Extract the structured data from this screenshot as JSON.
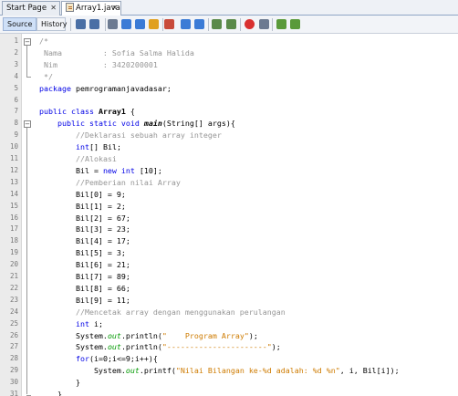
{
  "tabs": [
    {
      "label": "Start Page",
      "close": "✕"
    },
    {
      "label": "Array1.java",
      "close": "✕"
    }
  ],
  "toolbar": {
    "source_label": "Source",
    "history_label": "History"
  },
  "lines": [
    {
      "n": "1",
      "segs": [
        [
          "c",
          "/*"
        ]
      ]
    },
    {
      "n": "2",
      "segs": [
        [
          "c",
          " Nama         : Sofia Salma Halida"
        ]
      ]
    },
    {
      "n": "3",
      "segs": [
        [
          "c",
          " Nim          : 3420200001"
        ]
      ]
    },
    {
      "n": "4",
      "segs": [
        [
          "c",
          " */"
        ]
      ]
    },
    {
      "n": "5",
      "segs": [
        [
          "k",
          "package"
        ],
        [
          "n",
          " pemrogramanjavadasar;"
        ]
      ]
    },
    {
      "n": "6",
      "segs": []
    },
    {
      "n": "7",
      "segs": [
        [
          "k",
          "public class"
        ],
        [
          "b",
          " Array1"
        ],
        [
          "n",
          " {"
        ]
      ]
    },
    {
      "n": "8",
      "segs": [
        [
          "n",
          "    "
        ],
        [
          "k",
          "public static void"
        ],
        [
          "m",
          " main"
        ],
        [
          "n",
          "(String[] args){"
        ]
      ]
    },
    {
      "n": "9",
      "segs": [
        [
          "n",
          "        "
        ],
        [
          "c",
          "//Deklarasi sebuah array integer"
        ]
      ]
    },
    {
      "n": "10",
      "segs": [
        [
          "n",
          "        "
        ],
        [
          "k",
          "int"
        ],
        [
          "n",
          "[] Bil;"
        ]
      ]
    },
    {
      "n": "11",
      "segs": [
        [
          "n",
          "        "
        ],
        [
          "c",
          "//Alokasi"
        ]
      ]
    },
    {
      "n": "12",
      "segs": [
        [
          "n",
          "        Bil = "
        ],
        [
          "k",
          "new int"
        ],
        [
          "n",
          " [10];"
        ]
      ]
    },
    {
      "n": "13",
      "segs": [
        [
          "n",
          "        "
        ],
        [
          "c",
          "//Pemberian nilai Array"
        ]
      ]
    },
    {
      "n": "14",
      "segs": [
        [
          "n",
          "        Bil[0] = 9;"
        ]
      ]
    },
    {
      "n": "15",
      "segs": [
        [
          "n",
          "        Bil[1] = 2;"
        ]
      ]
    },
    {
      "n": "16",
      "segs": [
        [
          "n",
          "        Bil[2] = 67;"
        ]
      ]
    },
    {
      "n": "17",
      "segs": [
        [
          "n",
          "        Bil[3] = 23;"
        ]
      ]
    },
    {
      "n": "18",
      "segs": [
        [
          "n",
          "        Bil[4] = 17;"
        ]
      ]
    },
    {
      "n": "19",
      "segs": [
        [
          "n",
          "        Bil[5] = 3;"
        ]
      ]
    },
    {
      "n": "20",
      "segs": [
        [
          "n",
          "        Bil[6] = 21;"
        ]
      ]
    },
    {
      "n": "21",
      "segs": [
        [
          "n",
          "        Bil[7] = 89;"
        ]
      ]
    },
    {
      "n": "22",
      "segs": [
        [
          "n",
          "        Bil[8] = 66;"
        ]
      ]
    },
    {
      "n": "23",
      "segs": [
        [
          "n",
          "        Bil[9] = 11;"
        ]
      ]
    },
    {
      "n": "24",
      "segs": [
        [
          "n",
          "        "
        ],
        [
          "c",
          "//Mencetak array dengan menggunakan perulangan"
        ]
      ]
    },
    {
      "n": "25",
      "segs": [
        [
          "n",
          "        "
        ],
        [
          "k",
          "int"
        ],
        [
          "n",
          " i;"
        ]
      ]
    },
    {
      "n": "26",
      "segs": [
        [
          "n",
          "        System."
        ],
        [
          "f",
          "out"
        ],
        [
          "n",
          ".println("
        ],
        [
          "s",
          "\"    Program Array\""
        ],
        [
          "n",
          ");"
        ]
      ]
    },
    {
      "n": "27",
      "segs": [
        [
          "n",
          "        System."
        ],
        [
          "f",
          "out"
        ],
        [
          "n",
          ".println("
        ],
        [
          "s",
          "\"----------------------\""
        ],
        [
          "n",
          ");"
        ]
      ]
    },
    {
      "n": "28",
      "segs": [
        [
          "n",
          "        "
        ],
        [
          "k",
          "for"
        ],
        [
          "n",
          "(i=0;i<=9;i++){"
        ]
      ]
    },
    {
      "n": "29",
      "segs": [
        [
          "n",
          "            System."
        ],
        [
          "f",
          "out"
        ],
        [
          "n",
          ".printf("
        ],
        [
          "s",
          "\"Nilai Bilangan ke-%d adalah: %d %n\""
        ],
        [
          "n",
          ", i, Bil[i]);"
        ]
      ]
    },
    {
      "n": "30",
      "segs": [
        [
          "n",
          "        }"
        ]
      ]
    },
    {
      "n": "31",
      "segs": [
        [
          "n",
          "    }"
        ]
      ]
    }
  ],
  "colors": {
    "keyword": "#0000e6",
    "comment": "#969696",
    "string": "#ce7b00",
    "field": "#009900"
  },
  "icons": [
    "back-icon",
    "forward-icon",
    "find-icon",
    "prev-occurrence-icon",
    "next-occurrence-icon",
    "toggle-highlight-icon",
    "toggle-bookmark-icon",
    "prev-bookmark-icon",
    "next-bookmark-icon",
    "shift-left-icon",
    "shift-right-icon",
    "start-macro-icon",
    "stop-macro-icon",
    "comment-icon",
    "uncomment-icon"
  ]
}
